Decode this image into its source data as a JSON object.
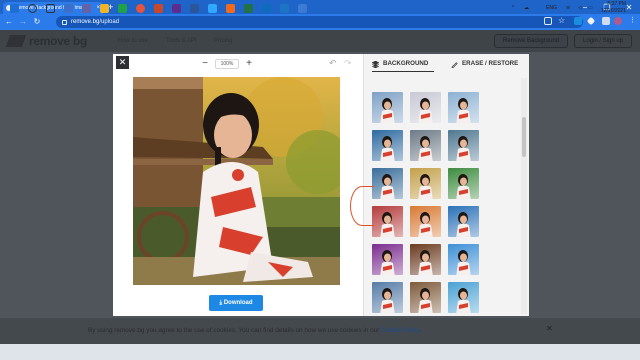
{
  "browser": {
    "tab_title": "Remove Background from Image",
    "new_tab_label": "+",
    "url_host": "remove.bg",
    "url_path": "/upload",
    "window_controls": [
      "−",
      "❐",
      "✕"
    ]
  },
  "site": {
    "logo_text": "remove bg",
    "nav": [
      "How to use",
      "Tools & API",
      "Pricing"
    ],
    "remove_background_button": "Remove Background",
    "login_button": "Login / Sign up"
  },
  "editor": {
    "close_label": "✕",
    "zoom_minus": "−",
    "zoom_value": "100%",
    "zoom_plus": "+",
    "undo_icon": "↶",
    "redo_icon": "↷",
    "download_label": "Download",
    "tabs": {
      "background": "BACKGROUND",
      "erase_restore": "ERASE / RESTORE"
    }
  },
  "thumbnails": [
    [
      "#7ea0c5",
      "#c9c9d6",
      "#8db1d2"
    ],
    [
      "#2e6aa1",
      "#6d7a86",
      "#4f7790"
    ],
    [
      "#3a6d9a",
      "#c3a04a",
      "#3d8b3f"
    ],
    [
      "#b43c3c",
      "#d97a34",
      "#2b71b8"
    ],
    [
      "#7b2c8e",
      "#6b3a1f",
      "#3c8fd6"
    ],
    [
      "#567ba6",
      "#7e5a3a",
      "#4aa1d4"
    ]
  ],
  "cookie_banner": {
    "text": "By using remove.bg you agree to the use of cookies. You can find details on how we use cookies in our",
    "link": "Cookie Policy",
    "close": "✕"
  },
  "taskbar": {
    "language": "ENG",
    "time": "8:37 PM",
    "date": "12/10/2021"
  },
  "colors": {
    "chrome_blue": "#2b7bea",
    "download_blue": "#1e88e5",
    "annotation": "#e0502a"
  }
}
